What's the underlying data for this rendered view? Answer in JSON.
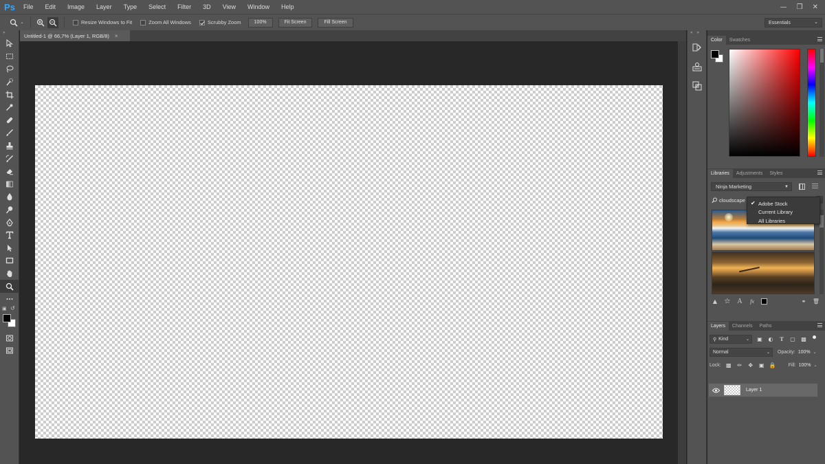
{
  "app": {
    "logo": "Ps",
    "menu": [
      "File",
      "Edit",
      "Image",
      "Layer",
      "Type",
      "Select",
      "Filter",
      "3D",
      "View",
      "Window",
      "Help"
    ]
  },
  "options_bar": {
    "resize_windows": "Resize Windows to Fit",
    "zoom_all": "Zoom All Windows",
    "scrubby_zoom": "Scrubby Zoom",
    "btn_100": "100%",
    "fit_screen": "Fit Screen",
    "fill_screen": "Fill Screen",
    "workspace": "Essentials"
  },
  "document": {
    "tab_title": "Untitled-1 @ 66,7% (Layer 1, RGB/8)",
    "tab_close": "×"
  },
  "color_panel": {
    "tabs": [
      "Color",
      "Swatches"
    ],
    "foreground": "#000000",
    "background": "#ffffff"
  },
  "libraries_panel": {
    "tabs": [
      "Libraries",
      "Adjustments",
      "Styles"
    ],
    "library": "Ninja Marketing",
    "search": "cloudscape sea",
    "scope_options": [
      "Adobe Stock",
      "Current Library",
      "All Libraries"
    ],
    "scope_selected": "Adobe Stock"
  },
  "layers_panel": {
    "tabs": [
      "Layers",
      "Channels",
      "Paths"
    ],
    "kind": "Kind",
    "blend_mode": "Normal",
    "opacity_label": "Opacity:",
    "opacity": "100%",
    "lock_label": "Lock:",
    "fill_label": "Fill:",
    "fill": "100%",
    "layers": [
      {
        "name": "Layer 1",
        "visible": true
      }
    ]
  }
}
